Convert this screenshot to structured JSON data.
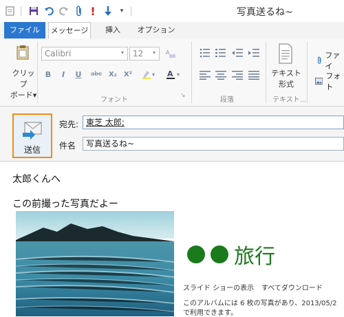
{
  "window": {
    "title": "写真送るね~"
  },
  "tabs": [
    "ファイル",
    "メッセージ",
    "挿入",
    "オプション"
  ],
  "ribbon": {
    "clipboard": {
      "label_line1": "クリップ",
      "label_line2": "ボード▾"
    },
    "font": {
      "family": "Calibri",
      "size": "12",
      "group_label": "フォント"
    },
    "paragraph": {
      "group_label": "段落"
    },
    "text_format": {
      "label_line1": "テキスト",
      "label_line2": "形式",
      "group_label": "テキスト..."
    },
    "attach_file": "ファイ",
    "photo_album": "フォト"
  },
  "compose": {
    "send_label": "送信",
    "to_label": "宛先:",
    "to_value": "東芝 太郎;",
    "subject_label": "件名",
    "subject_value": "写真送るね~"
  },
  "body": {
    "greeting": "太郎くんへ",
    "line2": "この前撮った写真だよー",
    "album": {
      "title": "旅行",
      "link_slideshow": "スライド ショーの表示",
      "link_download": "すべてダウンロード",
      "info_line1": "このアルバムには 6 枚の写真があり、2013/05/2",
      "info_line2": "で利用できます。"
    }
  },
  "colors": {
    "file_tab": "#2b78d0",
    "send_highlight": "#f28c18",
    "album_green": "#1b7a1b"
  }
}
